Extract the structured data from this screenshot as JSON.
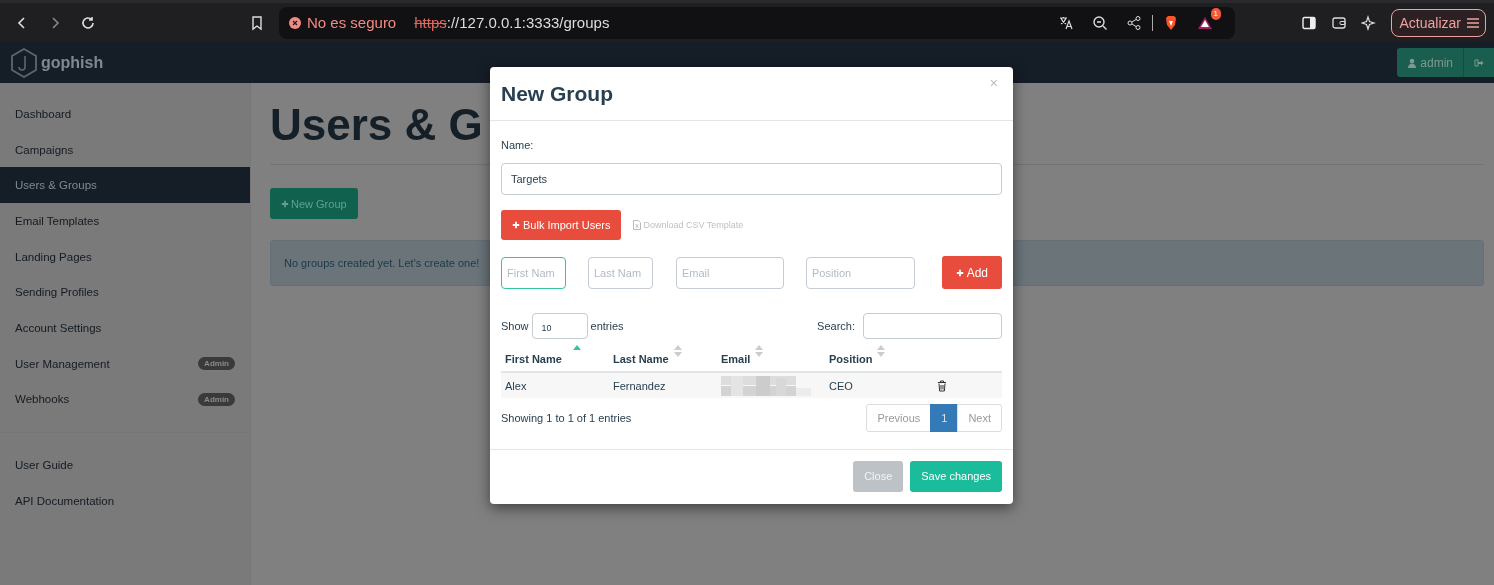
{
  "browser": {
    "security_label": "No es seguro",
    "url_scheme": "https",
    "url_rest": "://127.0.0.1:3333/groups",
    "notification_count": "1",
    "update_button": "Actualizar"
  },
  "navbar": {
    "brand": "gophish",
    "user_button": "admin"
  },
  "sidebar": {
    "items": [
      {
        "label": "Dashboard",
        "selected": false
      },
      {
        "label": "Campaigns",
        "selected": false
      },
      {
        "label": "Users & Groups",
        "selected": true
      },
      {
        "label": "Email Templates",
        "selected": false
      },
      {
        "label": "Landing Pages",
        "selected": false
      },
      {
        "label": "Sending Profiles",
        "selected": false
      },
      {
        "label": "Account Settings",
        "selected": false
      },
      {
        "label": "User Management",
        "selected": false,
        "badge": "Admin"
      },
      {
        "label": "Webhooks",
        "selected": false,
        "badge": "Admin"
      }
    ],
    "secondary_items": [
      {
        "label": "User Guide",
        "selected": false
      },
      {
        "label": "API Documentation",
        "selected": false
      }
    ]
  },
  "page": {
    "title": "Users & G",
    "new_group_button": "New Group",
    "alert": "No groups created yet. Let's create one!"
  },
  "modal": {
    "title": "New Group",
    "close": "×",
    "name_label": "Name:",
    "name_value": "Targets",
    "bulk_import_button": "Bulk Import Users",
    "download_link": "Download CSV Template",
    "target_fields": [
      {
        "placeholder": "First Nam",
        "focused": true
      },
      {
        "placeholder": "Last Nam",
        "focused": false
      },
      {
        "placeholder": "Email",
        "focused": false
      },
      {
        "placeholder": "Position",
        "focused": false
      }
    ],
    "add_button": "Add",
    "show_label": "Show",
    "page_length": "10",
    "entries_label": "entries",
    "search_label": "Search:",
    "columns": [
      {
        "label": "First Name",
        "sorted": true
      },
      {
        "label": "Last Name",
        "sorted": false
      },
      {
        "label": "Email",
        "sorted": false
      },
      {
        "label": "Position",
        "sorted": false
      }
    ],
    "rows": [
      {
        "first_name": "Alex",
        "last_name": "Fernandez",
        "email": {
          "kind": "redacted"
        },
        "position": "CEO"
      }
    ],
    "info": "Showing 1 to 1 of 1 entries",
    "pagination": {
      "previous": "Previous",
      "pages": [
        {
          "label": "1",
          "selected": true
        }
      ],
      "next": "Next"
    },
    "footer": {
      "close_button": "Close",
      "save_button": "Save changes"
    }
  }
}
